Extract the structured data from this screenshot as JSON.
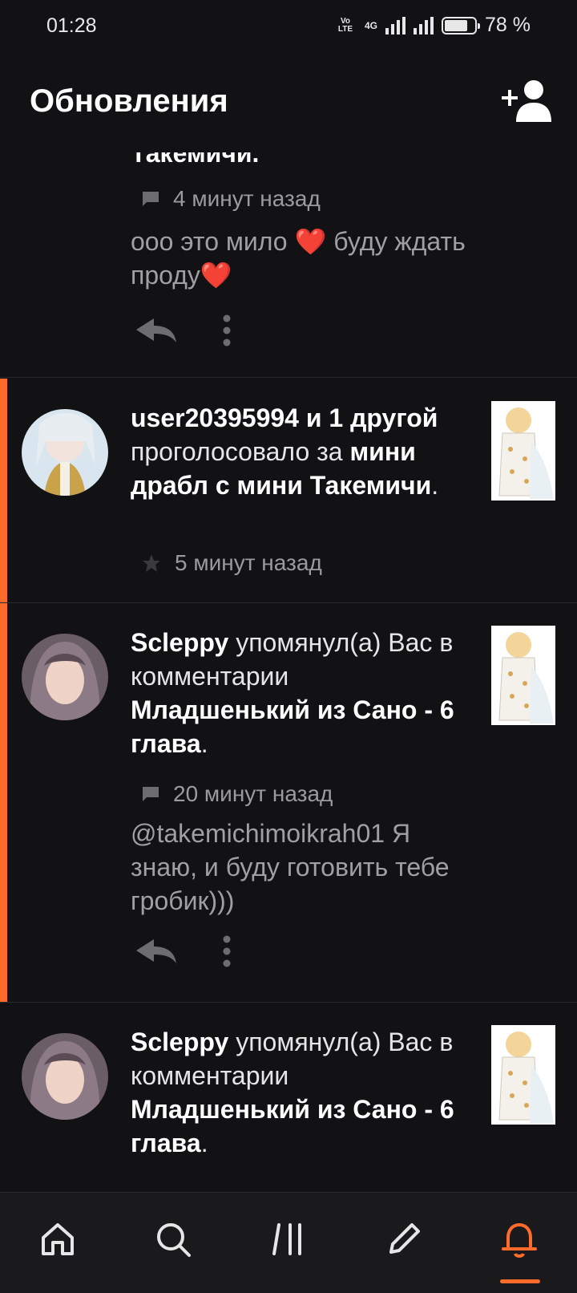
{
  "status": {
    "time": "01:28",
    "network": "4G",
    "volte": "Vo LTE",
    "battery": "78 %",
    "battery_level": 0.78
  },
  "header": {
    "title": "Обновления",
    "add_friend_icon": "add-user-icon"
  },
  "feed": [
    {
      "title_tail": "Такемичи.",
      "meta_icon": "comment-icon",
      "time": "4 минут назад",
      "quote_1": "ооо это мило ",
      "quote_heart": "❤️",
      "quote_2": " буду ждать проду",
      "quote_heart2": "❤️"
    },
    {
      "user": "user20395994 и 1 другой",
      "action": " проголосовало за ",
      "story": "мини драбл с мини Такемичи",
      "dot": ".",
      "meta_icon": "star-icon",
      "time": "5 минут назад"
    },
    {
      "user": "Sclepру",
      "action": " упомянул(а) Вас в комментарии ",
      "story": "Младшенький из Сано - 6 глава",
      "dot": ".",
      "meta_icon": "comment-icon",
      "time": "20 минут назад",
      "quote": "@takemichimoikrah01 Я знаю, и буду готовить тебе гробик)))"
    },
    {
      "user": "Sclepру",
      "action": " упомянул(а) Вас в комментарии ",
      "story": "Младшенький из Сано - 6 глава",
      "dot": "."
    }
  ],
  "nav": {
    "items": [
      "home-icon",
      "search-icon",
      "library-icon",
      "write-icon",
      "notifications-icon"
    ],
    "active": "notifications-icon"
  },
  "colors": {
    "accent": "#ff6b2a",
    "background": "#121114"
  }
}
